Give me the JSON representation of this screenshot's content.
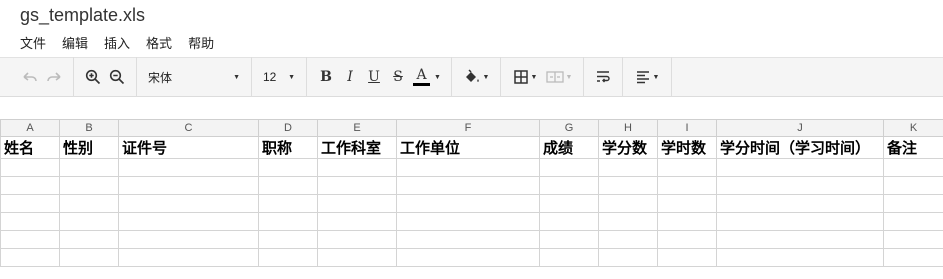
{
  "app": {
    "title": "gs_template.xls"
  },
  "menu": [
    "文件",
    "编辑",
    "插入",
    "格式",
    "帮助"
  ],
  "toolbar": {
    "font_family": "宋体",
    "font_size": "12",
    "bold": "B",
    "italic": "I",
    "underline": "U",
    "strike": "S",
    "text_color_label": "A",
    "text_color": "#000000",
    "icons": [
      "undo-icon",
      "redo-icon",
      "zoom-in-icon",
      "zoom-out-icon",
      "paint-bucket-icon",
      "borders-icon",
      "merge-cells-icon",
      "wrap-text-icon",
      "align-left-icon"
    ]
  },
  "sheet": {
    "columns": [
      "A",
      "B",
      "C",
      "D",
      "E",
      "F",
      "G",
      "H",
      "I",
      "J",
      "K"
    ],
    "header_row": [
      "姓名",
      "性别",
      "证件号",
      "职称",
      "工作科室",
      "工作单位",
      "成绩",
      "学分数",
      "学时数",
      "学分时间（学习时间）",
      "备注"
    ],
    "empty_rows": 6
  }
}
